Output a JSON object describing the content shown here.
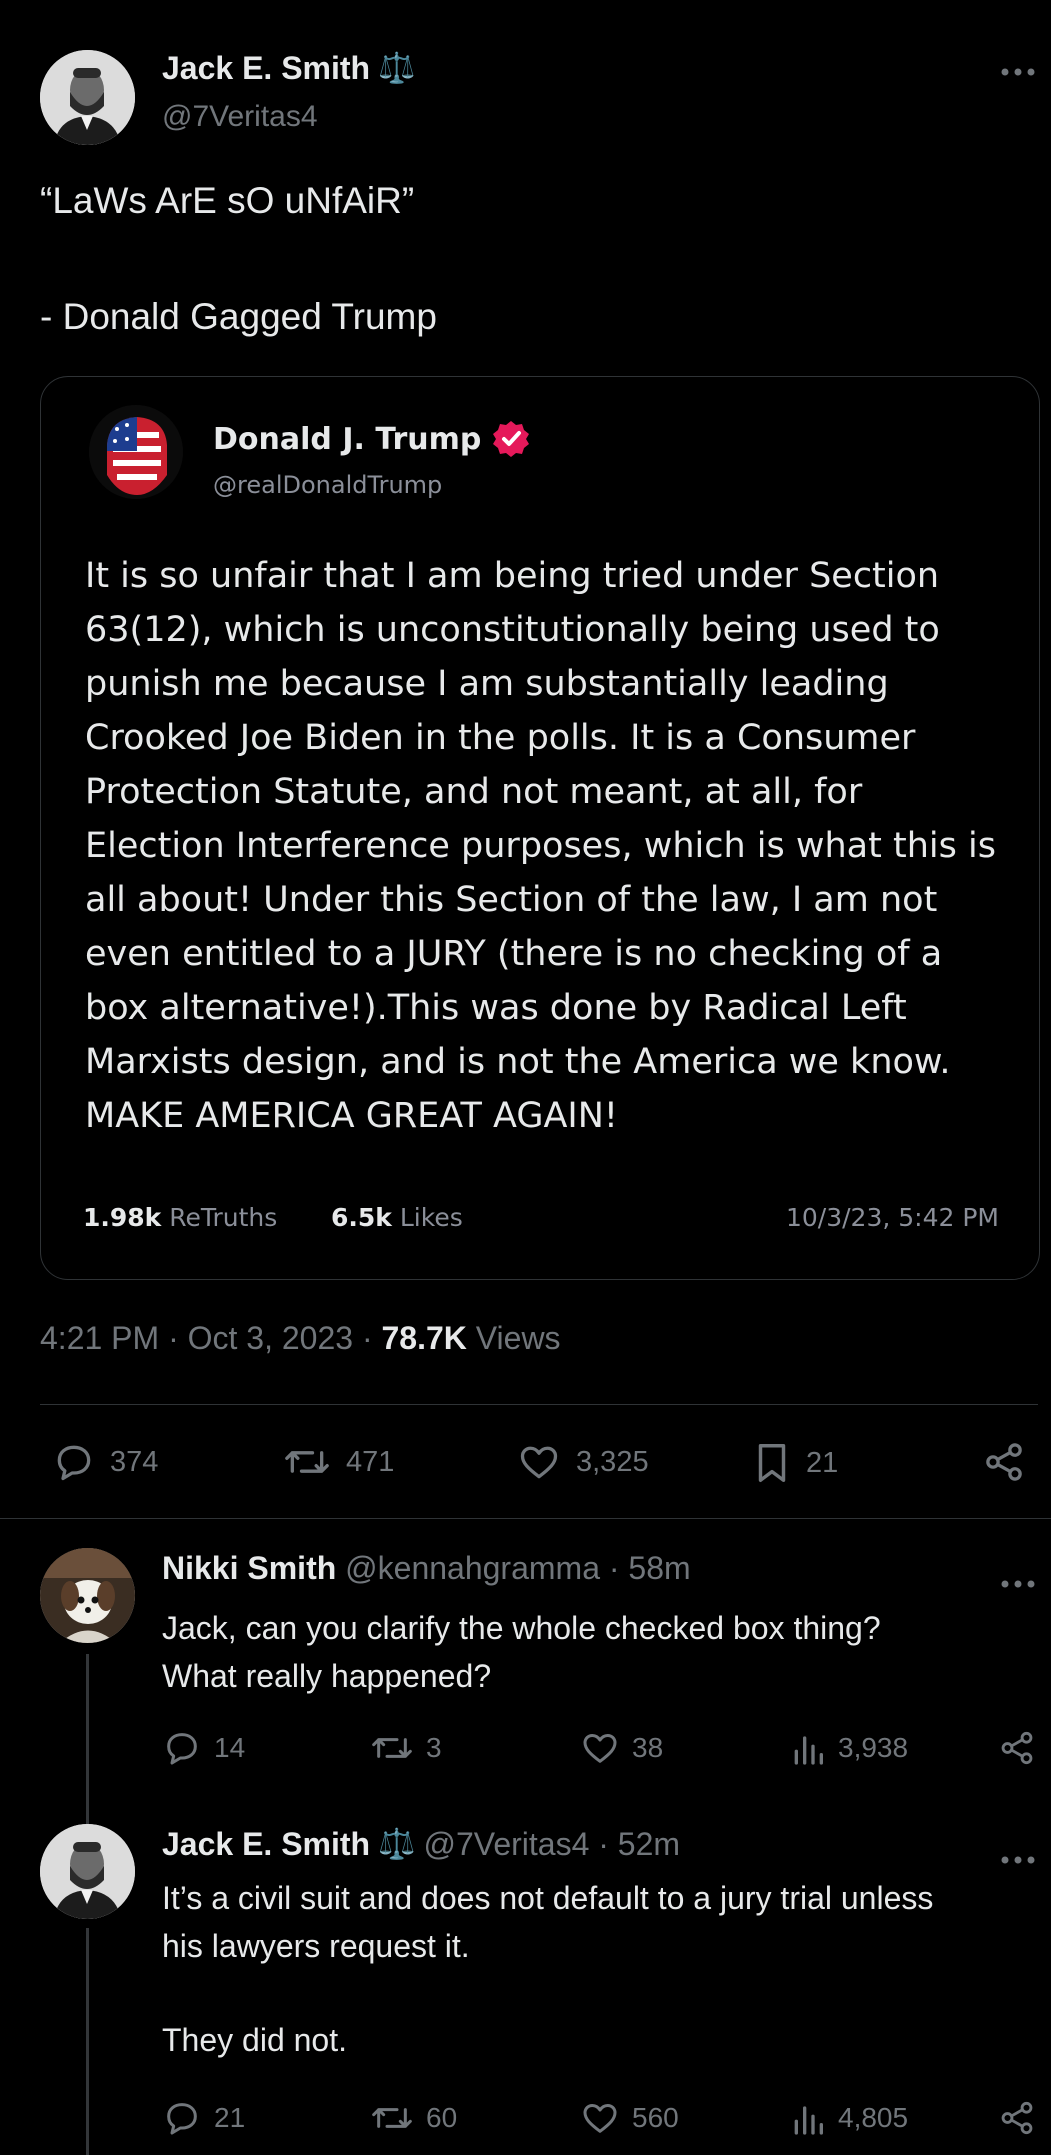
{
  "main_tweet": {
    "author_name": "Jack E. Smith",
    "author_emoji": "⚖️",
    "handle": "@7Veritas4",
    "text_line1": "“LaWs ArE sO uNfAiR”",
    "text_line2": "- Donald Gagged Trump",
    "timestamp": "4:21 PM · Oct 3, 2023 · ",
    "views_count": "78.7K",
    "views_label": " Views",
    "replies": "374",
    "reposts": "471",
    "likes": "3,325",
    "bookmarks": "21"
  },
  "quoted_post": {
    "author_name": "Donald J. Trump",
    "handle": "@realDonaldTrump",
    "text": "It is so unfair that I am being tried under Section 63(12), which is unconstitutionally being used to punish me because I am substantially leading Crooked Joe Biden in the polls. It is a Consumer Protection Statute, and not meant, at all, for Election Interference purposes, which is what this is all about! Under this Section of the law, I am not even entitled to a JURY (there is no checking of a box alternative!).This was done by Radical Left Marxists design, and is not the America we know. MAKE AMERICA GREAT AGAIN!",
    "retruths_count": "1.98k",
    "retruths_label": "ReTruths",
    "likes_count": "6.5k",
    "likes_label": "Likes",
    "date": "10/3/23, 5:42 PM"
  },
  "replies": [
    {
      "author_name": "Nikki Smith",
      "handle": "@kennahgramma · 58m",
      "text_line1": "Jack, can you clarify the whole checked box thing?",
      "text_line2": "What really happened?",
      "replies": "14",
      "reposts": "3",
      "likes": "38",
      "views": "3,938"
    },
    {
      "author_name": "Jack E. Smith",
      "author_emoji": "⚖️",
      "handle": "@7Veritas4 · 52m",
      "text_line1": "It’s a civil suit and does not default to a jury trial unless",
      "text_line2": "his lawyers request it.",
      "text_line3": "They did not.",
      "replies": "21",
      "reposts": "60",
      "likes": "560",
      "views": "4,805"
    }
  ],
  "icons": {
    "more": "more-icon",
    "reply": "reply-icon",
    "repost": "repost-icon",
    "like": "heart-icon",
    "bookmark": "bookmark-icon",
    "share": "share-icon",
    "views": "views-icon",
    "verified": "verified-badge-icon"
  },
  "colors": {
    "background": "#000000",
    "text": "#e7e9ea",
    "muted": "#71767b",
    "verified": "#e5195a",
    "border": "#2f3336"
  }
}
